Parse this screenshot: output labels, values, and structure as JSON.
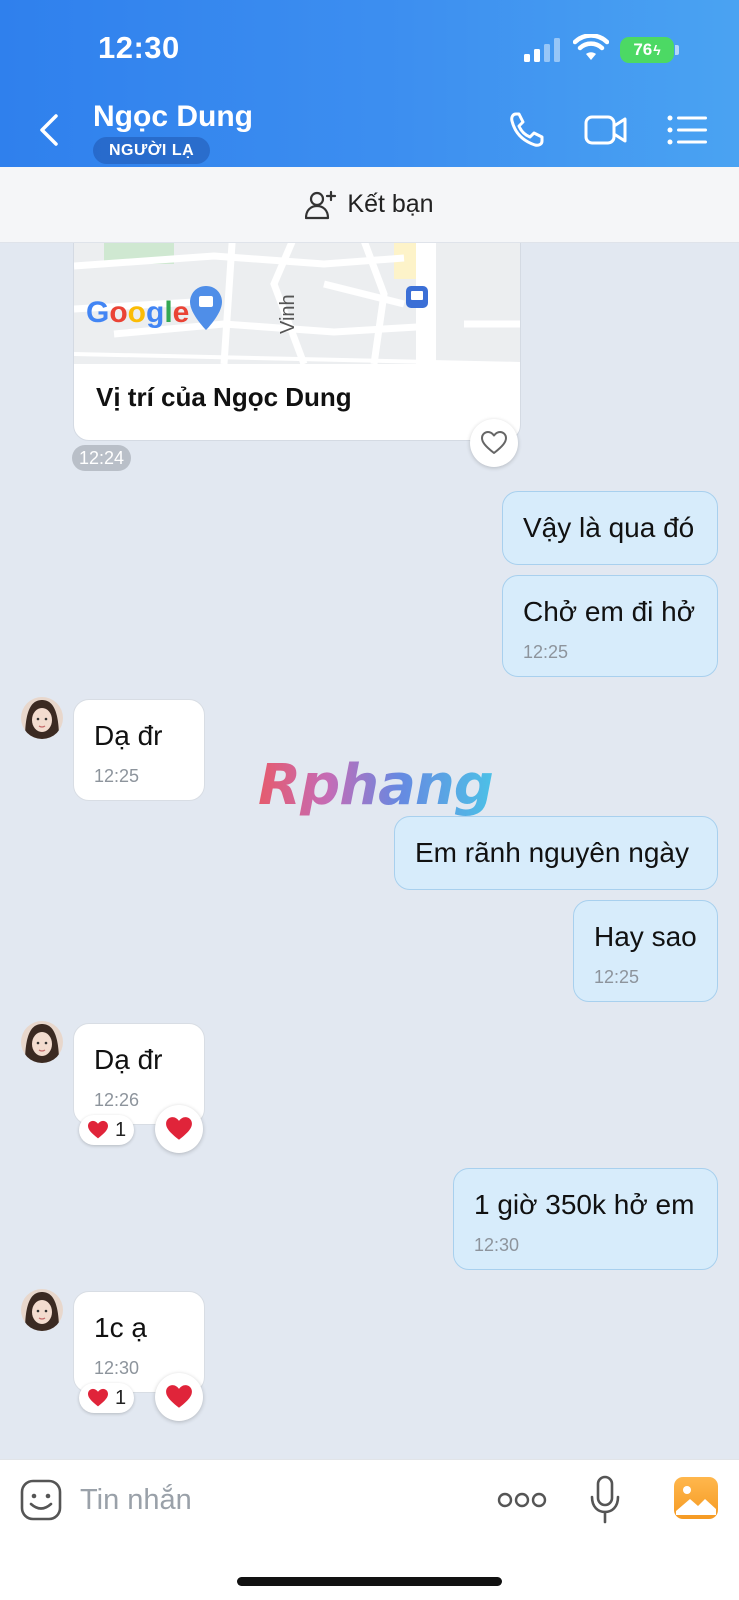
{
  "status_bar": {
    "time": "12:30",
    "battery": "76"
  },
  "header": {
    "contact_name": "Ngọc Dung",
    "badge": "NGƯỜI LẠ"
  },
  "add_friend": {
    "label": "Kết bạn"
  },
  "map_card": {
    "map_brand": "Google",
    "street_label": "Vinh",
    "title": "Vị trí của Ngọc Dung",
    "time": "12:24"
  },
  "messages": [
    {
      "dir": "out",
      "text": "Vậy là qua đó",
      "time": ""
    },
    {
      "dir": "out",
      "text": "Chở em đi hở",
      "time": "12:25"
    },
    {
      "dir": "in",
      "text": "Dạ đr",
      "time": "12:25"
    },
    {
      "dir": "out",
      "text": "Em rãnh nguyên ngày",
      "time": ""
    },
    {
      "dir": "out",
      "text": "Hay sao",
      "time": "12:25"
    },
    {
      "dir": "in",
      "text": "Dạ đr",
      "time": "12:26",
      "reaction_count": "1"
    },
    {
      "dir": "out",
      "text": "1 giờ 350k hở em",
      "time": "12:30"
    },
    {
      "dir": "in",
      "text": "1c ạ",
      "time": "12:30",
      "reaction_count": "1"
    }
  ],
  "watermark": "Rphang",
  "composer": {
    "placeholder": "Tin nhắn"
  },
  "colors": {
    "header": "#3d8ff0",
    "outgoing_bubble": "#d7ecfb",
    "incoming_bubble": "#ffffff",
    "reaction": "#e0243a"
  },
  "icons": [
    "back-chevron-icon",
    "phone-icon",
    "video-call-icon",
    "menu-list-icon",
    "add-friend-icon",
    "heart-icon",
    "emoji-icon",
    "more-dots-icon",
    "microphone-icon",
    "gallery-icon"
  ]
}
